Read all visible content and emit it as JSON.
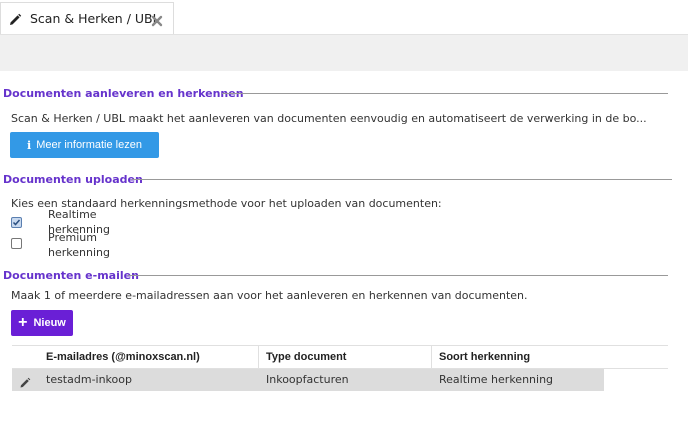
{
  "tab": {
    "label": "Scan & Herken / UBL",
    "edit_icon": "pencil-icon",
    "close_icon": "close-icon"
  },
  "section_upload": {
    "title": "Documenten aanleveren en herkennen",
    "description": "Scan & Herken / UBL maakt het aanleveren van documenten eenvoudig en automatiseert de verwerking in de bo...",
    "button_label": "Meer informatie lezen",
    "button_icon": "info-icon",
    "button_color": "#3399e6"
  },
  "section_uploaden": {
    "title": "Documenten uploaden",
    "description": "Kies een standaard herkenningsmethode voor het uploaden van documenten:",
    "options": [
      {
        "label": "Realtime\nherkenning",
        "checked": true
      },
      {
        "label": "Premium\nherkenning",
        "checked": false
      }
    ]
  },
  "section_email": {
    "title": "Documenten e-mailen",
    "description": "Maak 1 of meerdere e-mailadressen aan voor het aanleveren en herkennen van documenten.",
    "new_button_label": "Nieuw",
    "new_button_color": "#6a1fd6",
    "table": {
      "columns": [
        "E-mailadres (@minoxscan.nl)",
        "Type document",
        "Soort herkenning"
      ],
      "rows": [
        {
          "email": "testadm-inkoop",
          "type": "Inkoopfacturen",
          "soort": "Realtime herkenning"
        }
      ]
    }
  },
  "colors": {
    "section_title": "#6633cc",
    "row_highlight": "#dcdcdc"
  }
}
